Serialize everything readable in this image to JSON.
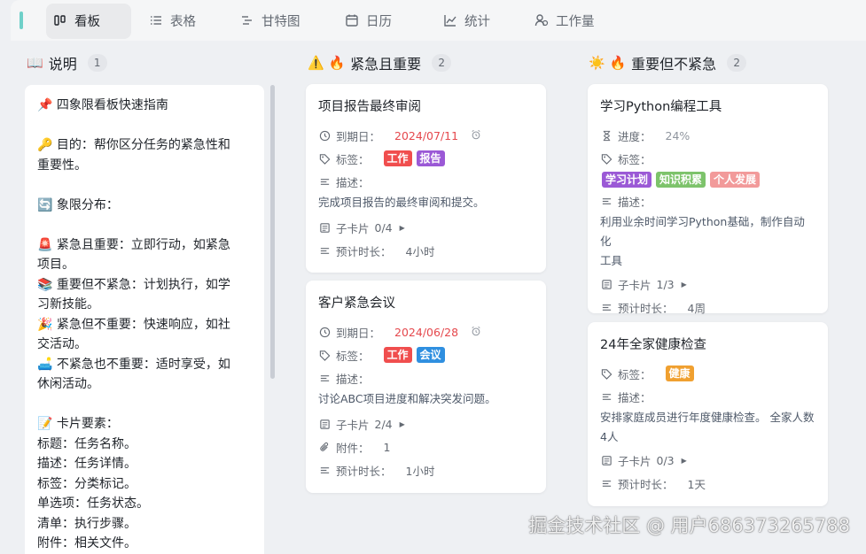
{
  "tabs": [
    {
      "label": "看板",
      "icon": "board-icon"
    },
    {
      "label": "表格",
      "icon": "list-icon"
    },
    {
      "label": "甘特图",
      "icon": "gantt-icon"
    },
    {
      "label": "日历",
      "icon": "calendar-icon"
    },
    {
      "label": "统计",
      "icon": "chart-icon"
    },
    {
      "label": "工作量",
      "icon": "workload-icon"
    }
  ],
  "columns": {
    "notes": {
      "emoji": "📖",
      "title": "说明",
      "count": "1"
    },
    "urgent_important": {
      "emoji": "⚠️ 🔥",
      "title": "紧急且重要",
      "count": "2"
    },
    "important_not_urgent": {
      "emoji": "☀️ 🔥",
      "title": "重要但不紧急",
      "count": "2"
    }
  },
  "notes_lines": [
    "📌 四象限看板快速指南",
    "",
    "🔑 目的：帮你区分任务的紧急性和",
    "重要性。",
    "",
    "🔄 象限分布：",
    "",
    "🚨 紧急且重要：立即行动，如紧急",
    "项目。",
    "📚 重要但不紧急：计划执行，如学",
    "习新技能。",
    "🎉 紧急但不重要：快速响应，如社",
    "交活动。",
    "🛋️ 不紧急也不重要：适时享受，如",
    "休闲活动。",
    "",
    "📝 卡片要素：",
    "标题：任务名称。",
    "描述：任务详情。",
    "标签：分类标记。",
    "单选项：任务状态。",
    "清单：执行步骤。",
    "附件：相关文件。"
  ],
  "labels": {
    "due": "到期日：",
    "tags": "标签：",
    "desc": "描述：",
    "subcards": "子卡片",
    "estimate": "预计时长：",
    "attachments": "附件：",
    "progress": "进度："
  },
  "cards": {
    "c1": {
      "title": "项目报告最终审阅",
      "due": "2024/07/11",
      "tags": [
        {
          "text": "工作",
          "color": "#f04e4e"
        },
        {
          "text": "报告",
          "color": "#9b59d6"
        }
      ],
      "desc": "完成项目报告的最终审阅和提交。",
      "subcards": "0/4",
      "estimate": "4小时"
    },
    "c2": {
      "title": "客户紧急会议",
      "due": "2024/06/28",
      "tags": [
        {
          "text": "工作",
          "color": "#f04e4e"
        },
        {
          "text": "会议",
          "color": "#2f8fe0"
        }
      ],
      "desc": "讨论ABC项目进度和解决突发问题。",
      "subcards": "2/4",
      "attachments": "1",
      "estimate": "1小时"
    },
    "c3": {
      "title": "学习Python编程工具",
      "progress": "24%",
      "tags": [
        {
          "text": "学习计划",
          "color": "#9b59d6"
        },
        {
          "text": "知识积累",
          "color": "#7dc36b"
        },
        {
          "text": "个人发展",
          "color": "#f29a9a"
        }
      ],
      "desc_lines": [
        "利用业余时间学习Python基础，制作自动化",
        "工具"
      ],
      "subcards": "1/3",
      "estimate": "4周"
    },
    "c4": {
      "title": "24年全家健康检查",
      "tags": [
        {
          "text": "健康",
          "color": "#f0a030"
        }
      ],
      "desc_lines": [
        "安排家庭成员进行年度健康检查。 全家人数",
        "4人"
      ],
      "subcards": "0/3",
      "estimate": "1天"
    }
  },
  "watermark": "掘金技术社区 @ 用户686373265788"
}
